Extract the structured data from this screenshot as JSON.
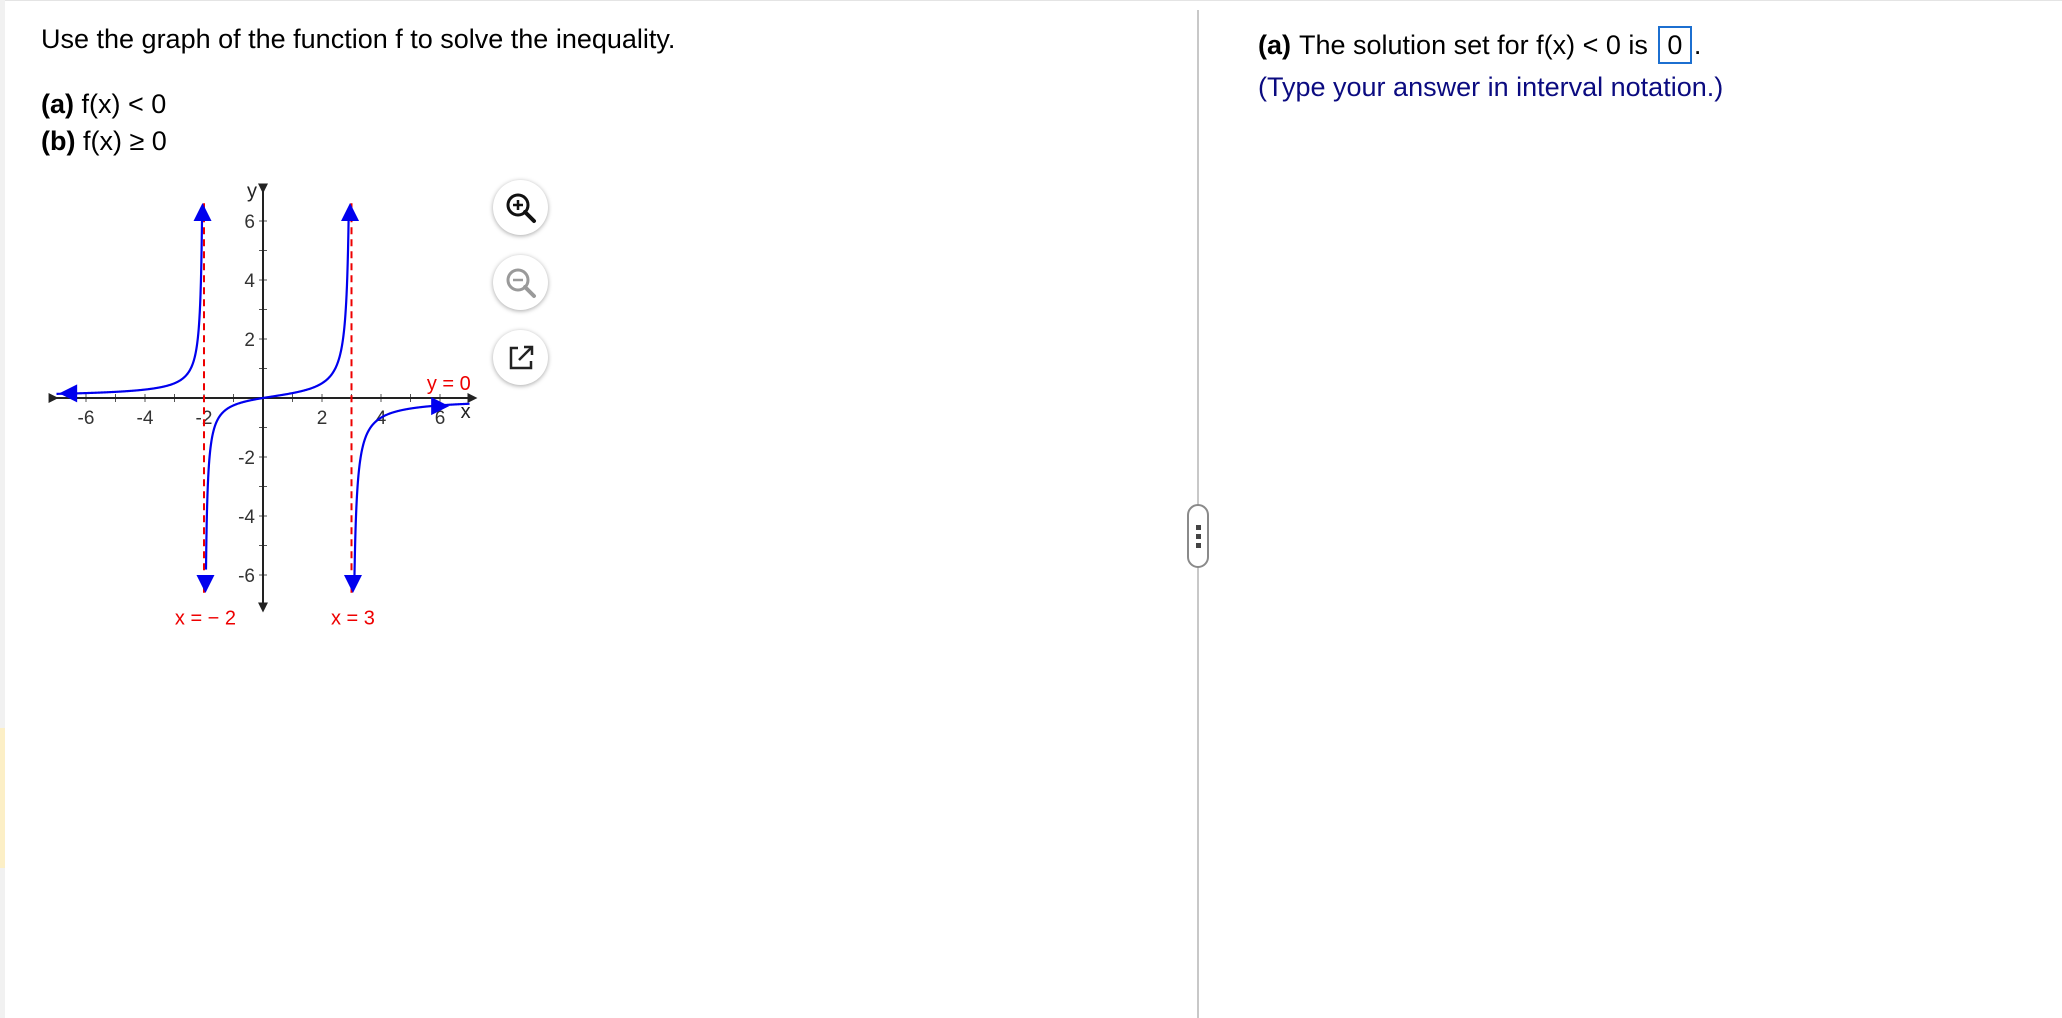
{
  "question": {
    "instruction": "Use the graph of the function f to solve the inequality.",
    "parts": [
      {
        "tag": "(a)",
        "expr": "f(x) < 0"
      },
      {
        "tag": "(b)",
        "expr": "f(x) ≥ 0"
      }
    ]
  },
  "graph": {
    "x_axis_label": "x",
    "y_axis_label": "y",
    "x_ticks": [
      "-6",
      "-4",
      "-2",
      "2",
      "4",
      "6"
    ],
    "y_ticks": [
      "6",
      "4",
      "2",
      "-2",
      "-4",
      "-6"
    ],
    "xlim": [
      -6,
      6
    ],
    "ylim": [
      -6,
      6
    ],
    "asymptote_labels": [
      "x = − 2",
      "x = 3",
      "y = 0"
    ],
    "vertical_asymptotes": [
      -2,
      3
    ],
    "horizontal_asymptote": 0,
    "curve_color": "#0000ee",
    "asymptote_color": "#ee0000"
  },
  "graph_tools": [
    {
      "name": "zoom-in-icon",
      "label": "Zoom in"
    },
    {
      "name": "zoom-out-icon",
      "label": "Zoom out"
    },
    {
      "name": "popout-icon",
      "label": "Open in new window"
    }
  ],
  "answer": {
    "tag": "(a)",
    "prompt": "The solution set for f(x) < 0 is",
    "value": "0",
    "period": ".",
    "hint": "(Type your answer in interval notation.)"
  },
  "colors": {
    "answer_box_border": "#1c6fd0",
    "hint_text": "#0b0b80"
  }
}
